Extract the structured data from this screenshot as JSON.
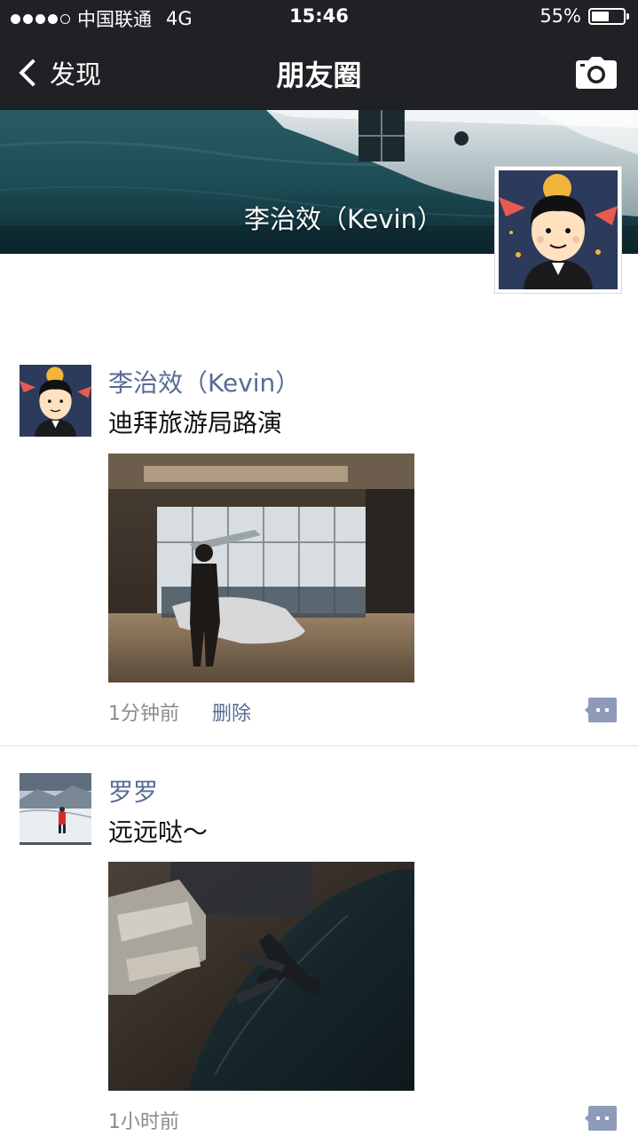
{
  "status_bar": {
    "carrier": "中国联通",
    "network": "4G",
    "time": "15:46",
    "battery": "55%",
    "battery_level": 0.55,
    "signal_bars_filled": 4,
    "signal_bars_total": 5
  },
  "nav": {
    "back_label": "发现",
    "title": "朋友圈",
    "camera_icon": "camera-icon"
  },
  "cover": {
    "user_name": "李治效（Kevin）"
  },
  "posts": [
    {
      "author": "李治效（Kevin）",
      "text": "迪拜旅游局路演",
      "time": "1分钟前",
      "delete_label": "删除"
    },
    {
      "author": "罗罗",
      "text": "远远哒～",
      "time": "1小时前"
    }
  ],
  "colors": {
    "nav_background": "#1f2124",
    "link_blue": "#576b95",
    "secondary_text": "#8a8a8a",
    "comment_icon": "#8e9bb8"
  }
}
